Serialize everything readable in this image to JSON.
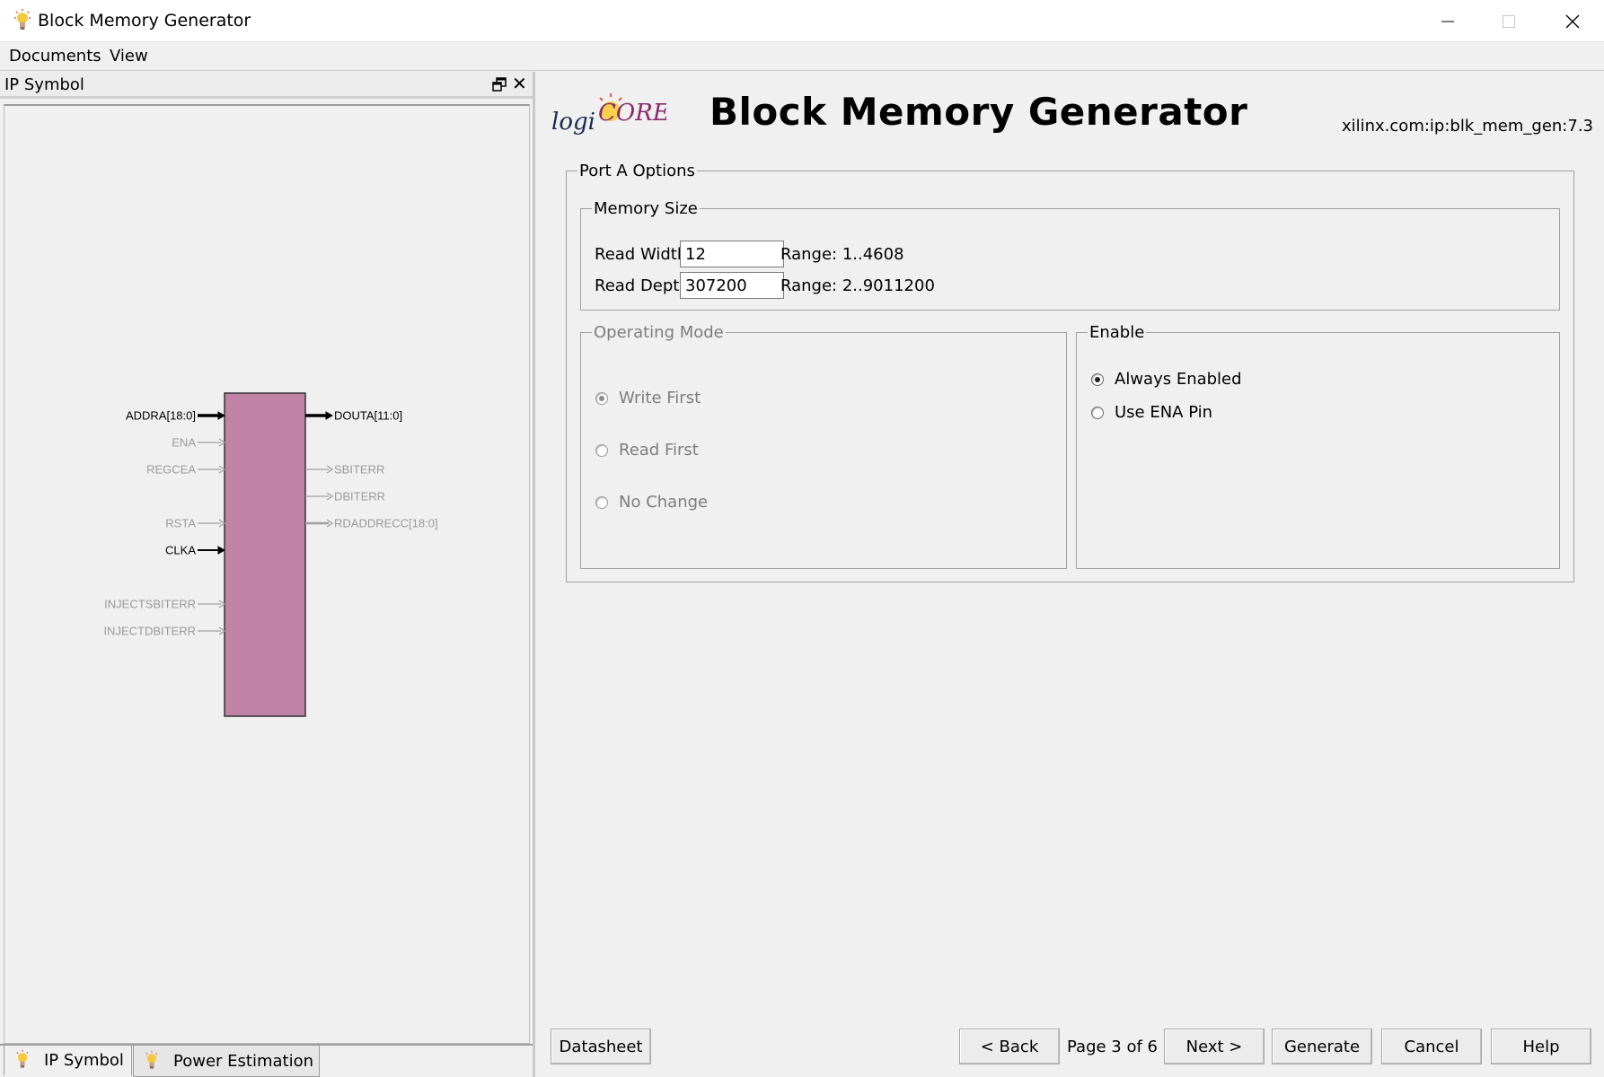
{
  "window": {
    "title": "Block Memory Generator"
  },
  "menu": [
    "Documents",
    "View"
  ],
  "left_panel": {
    "title": "IP Symbol",
    "symbol": {
      "block_color": "#c083a6",
      "inputs": [
        {
          "label": "ADDRA[18:0]",
          "active": true,
          "bus": true
        },
        {
          "label": "ENA",
          "active": false,
          "bus": false
        },
        {
          "label": "REGCEA",
          "active": false,
          "bus": false
        },
        {
          "label": "RSTA",
          "active": false,
          "bus": false
        },
        {
          "label": "CLKA",
          "active": true,
          "bus": false
        },
        {
          "label": "INJECTSBITERR",
          "active": false,
          "bus": false
        },
        {
          "label": "INJECTDBITERR",
          "active": false,
          "bus": false
        }
      ],
      "outputs": [
        {
          "label": "DOUTA[11:0]",
          "active": true,
          "bus": true
        },
        {
          "label": "SBITERR",
          "active": false,
          "bus": false
        },
        {
          "label": "DBITERR",
          "active": false,
          "bus": false
        },
        {
          "label": "RDADDRECC[18:0]",
          "active": false,
          "bus": true
        }
      ]
    },
    "tabs": [
      "IP Symbol",
      "Power Estimation"
    ]
  },
  "header": {
    "logo_text_1": "logi",
    "logo_text_2": "CORE",
    "title": "Block Memory Generator",
    "vlnv": "xilinx.com:ip:blk_mem_gen:7.3"
  },
  "port_a": {
    "legend": "Port A Options",
    "memory_size": {
      "legend": "Memory Size",
      "read_width_label": "Read Width",
      "read_width_value": "12",
      "read_width_range": "Range: 1..4608",
      "read_depth_label": "Read Depth",
      "read_depth_value": "307200",
      "read_depth_range": "Range: 2..9011200"
    },
    "operating_mode": {
      "legend": "Operating Mode",
      "options": [
        "Write First",
        "Read First",
        "No Change"
      ],
      "selected": "Write First",
      "enabled": false
    },
    "enable": {
      "legend": "Enable",
      "options": [
        "Always Enabled",
        "Use ENA Pin"
      ],
      "selected": "Always Enabled"
    }
  },
  "footer": {
    "datasheet": "Datasheet",
    "back": "< Back",
    "page": "Page 3 of 6",
    "next": "Next >",
    "generate": "Generate",
    "cancel": "Cancel",
    "help": "Help"
  }
}
